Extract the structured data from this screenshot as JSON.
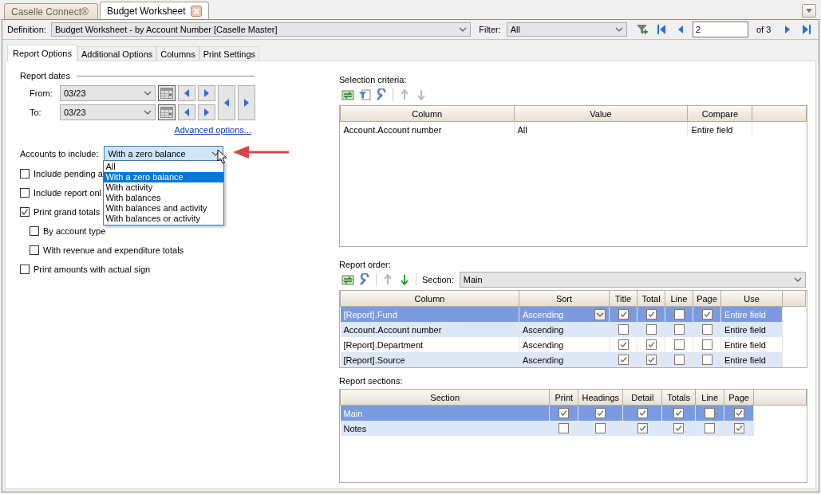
{
  "doc_tabs": [
    {
      "label": "Caselle Connect®",
      "selected": false,
      "closable": false
    },
    {
      "label": "Budget Worksheet",
      "selected": true,
      "closable": true
    }
  ],
  "toolbar": {
    "definition_label": "Definition:",
    "definition": "Budget Worksheet - by Account Number [Caselle Master]",
    "filter_label": "Filter:",
    "filter": "All",
    "page": "2",
    "page_of": "of 3"
  },
  "option_tabs": [
    {
      "label": "Report Options",
      "selected": true
    },
    {
      "label": "Additional Options",
      "selected": false
    },
    {
      "label": "Columns",
      "selected": false
    },
    {
      "label": "Print Settings",
      "selected": false
    }
  ],
  "report_dates": {
    "title": "Report dates",
    "from_label": "From:",
    "from": "03/23",
    "to_label": "To:",
    "to": "03/23",
    "advanced_link": "Advanced options..."
  },
  "accounts": {
    "label": "Accounts to include:",
    "value": "With a zero balance",
    "expanded": true,
    "options": [
      {
        "label": "All",
        "selected": false
      },
      {
        "label": "With a zero balance",
        "selected": true
      },
      {
        "label": "With activity",
        "selected": false
      },
      {
        "label": "With balances",
        "selected": false
      },
      {
        "label": "With balances and activity",
        "selected": false
      },
      {
        "label": "With balances or activity",
        "selected": false
      }
    ]
  },
  "checks": [
    {
      "label": "Include pending a",
      "checked": false
    },
    {
      "label": "Include report onl",
      "checked": false
    },
    {
      "label": "Print grand totals",
      "checked": true,
      "children": [
        {
          "label": "By account type",
          "checked": false
        },
        {
          "label": "With revenue and expenditure totals",
          "checked": false
        }
      ]
    },
    {
      "label": "Print amounts with actual sign",
      "checked": false
    }
  ],
  "selection_criteria": {
    "title": "Selection criteria:",
    "columns": [
      "Column",
      "Value",
      "Compare"
    ],
    "rows": [
      [
        "Account.Account number",
        "All",
        "Entire field"
      ]
    ]
  },
  "report_order": {
    "title": "Report order:",
    "section_label": "Section:",
    "section": "Main",
    "columns": [
      "Column",
      "Sort",
      "Title",
      "Total",
      "Line",
      "Page",
      "Use"
    ],
    "rows": [
      {
        "column": "[Report].Fund",
        "sort": "Ascending",
        "title": true,
        "total": true,
        "line": false,
        "page": true,
        "use": "Entire field",
        "selected": true
      },
      {
        "column": "Account.Account number",
        "sort": "Ascending",
        "title": false,
        "total": false,
        "line": false,
        "page": false,
        "use": "Entire field",
        "selected": false
      },
      {
        "column": "[Report].Department",
        "sort": "Ascending",
        "title": true,
        "total": true,
        "line": false,
        "page": false,
        "use": "Entire field",
        "selected": false
      },
      {
        "column": "[Report].Source",
        "sort": "Ascending",
        "title": true,
        "total": true,
        "line": false,
        "page": false,
        "use": "Entire field",
        "selected": false
      }
    ]
  },
  "report_sections": {
    "title": "Report sections:",
    "columns": [
      "Section",
      "Print",
      "Headings",
      "Detail",
      "Totals",
      "Line",
      "Page"
    ],
    "rows": [
      {
        "section": "Main",
        "print": true,
        "headings": true,
        "detail": true,
        "totals": true,
        "line": false,
        "page": true,
        "selected": true
      },
      {
        "section": "Notes",
        "print": false,
        "headings": false,
        "detail": true,
        "totals": true,
        "line": false,
        "page": true,
        "selected": false
      }
    ]
  }
}
